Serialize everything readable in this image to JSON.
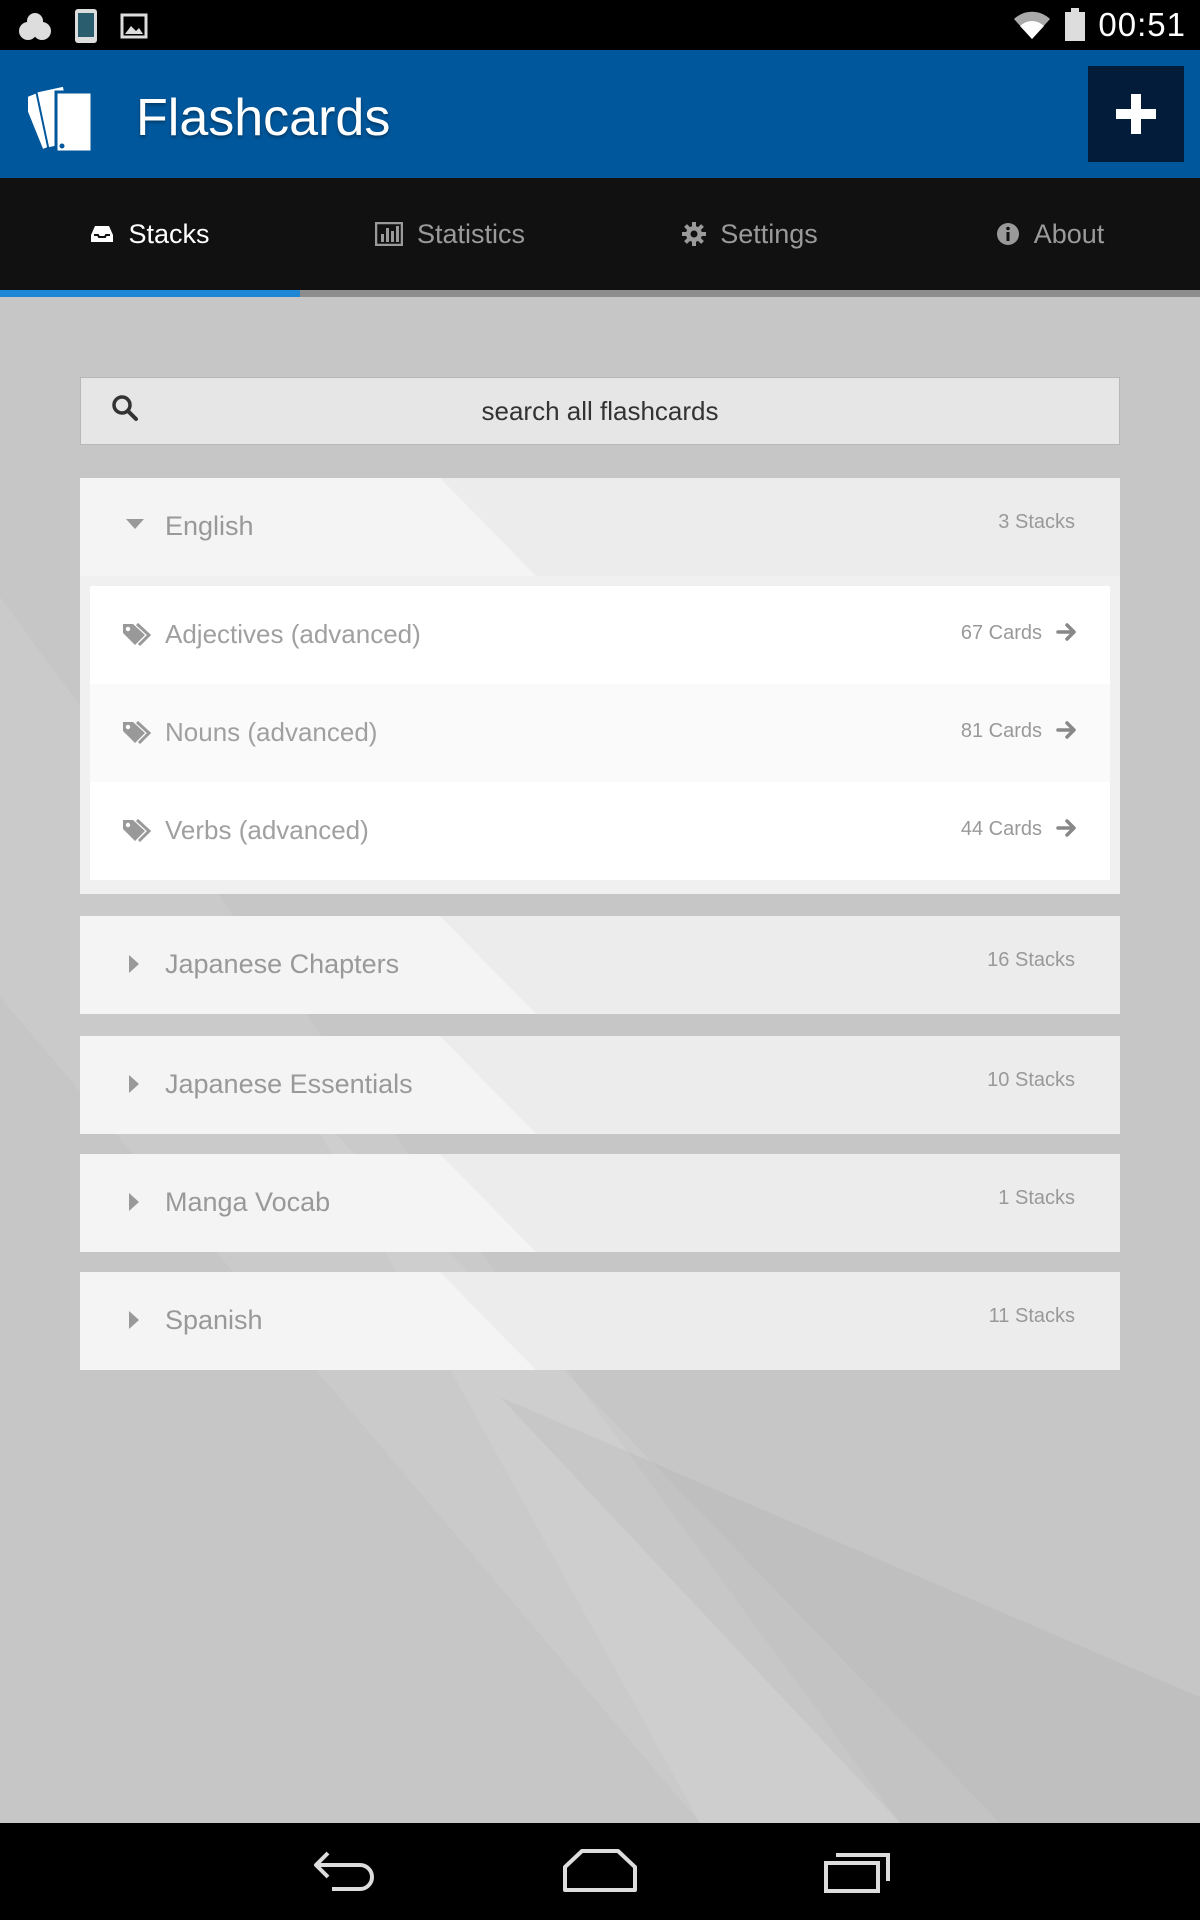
{
  "status_bar": {
    "time": "00:51"
  },
  "app": {
    "title": "Flashcards"
  },
  "tabs": [
    {
      "label": "Stacks",
      "icon": "inbox-icon",
      "active": true
    },
    {
      "label": "Statistics",
      "icon": "bar-chart-icon",
      "active": false
    },
    {
      "label": "Settings",
      "icon": "gear-icon",
      "active": false
    },
    {
      "label": "About",
      "icon": "info-icon",
      "active": false
    }
  ],
  "search": {
    "placeholder": "search all flashcards"
  },
  "groups": [
    {
      "name": "English",
      "count": "3 Stacks",
      "expanded": true,
      "stacks": [
        {
          "name": "Adjectives (advanced)",
          "count": "67 Cards"
        },
        {
          "name": "Nouns (advanced)",
          "count": "81 Cards"
        },
        {
          "name": "Verbs (advanced)",
          "count": "44 Cards"
        }
      ]
    },
    {
      "name": "Japanese Chapters",
      "count": "16 Stacks",
      "expanded": false
    },
    {
      "name": "Japanese Essentials",
      "count": "10 Stacks",
      "expanded": false
    },
    {
      "name": "Manga Vocab",
      "count": "1 Stacks",
      "expanded": false
    },
    {
      "name": "Spanish",
      "count": "11 Stacks",
      "expanded": false
    }
  ],
  "colors": {
    "appbar": "#01579b",
    "tab_active": "#1e88d6",
    "add_button": "#021c3a"
  }
}
